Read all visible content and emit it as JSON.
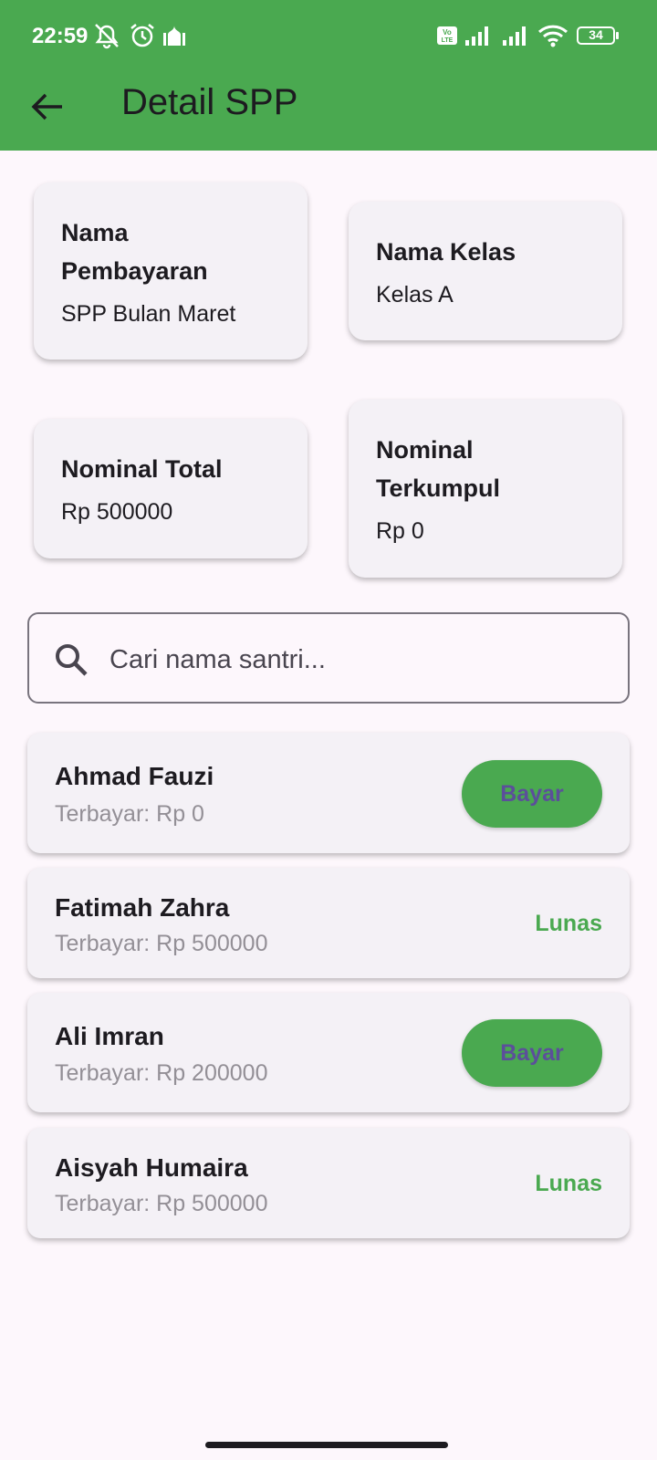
{
  "status_bar": {
    "time": "22:59",
    "battery": "34",
    "icons": [
      "mute-icon",
      "alarm-icon",
      "mosque-icon",
      "volte-icon",
      "signal-icon",
      "signal-icon",
      "wifi-icon",
      "battery-icon"
    ]
  },
  "header": {
    "title": "Detail SPP",
    "back_icon": "arrow-left-icon",
    "color": "#4aa950"
  },
  "info": {
    "nama_pembayaran": {
      "label_line1": "Nama",
      "label_line2": "Pembayaran",
      "value": "SPP Bulan Maret"
    },
    "nama_kelas": {
      "label": "Nama Kelas",
      "value": "Kelas A"
    },
    "nominal_total": {
      "label": "Nominal Total",
      "value": "Rp 500000"
    },
    "nominal_terkumpul": {
      "label_line1": "Nominal",
      "label_line2": "Terkumpul",
      "value": "Rp 0"
    }
  },
  "search": {
    "placeholder": "Cari nama santri...",
    "icon": "search-icon"
  },
  "students": [
    {
      "name": "Ahmad Fauzi",
      "paid": "Terbayar: Rp 0",
      "action": "Bayar"
    },
    {
      "name": "Fatimah Zahra",
      "paid": "Terbayar: Rp 500000",
      "status": "Lunas"
    },
    {
      "name": "Ali Imran",
      "paid": "Terbayar: Rp 200000",
      "action": "Bayar"
    },
    {
      "name": "Aisyah Humaira",
      "paid": "Terbayar: Rp 500000",
      "status": "Lunas"
    }
  ],
  "colors": {
    "accent": "#4aa950",
    "button_text": "#5b4f9a",
    "background": "#fdf7fc",
    "card": "#f4f1f6"
  }
}
